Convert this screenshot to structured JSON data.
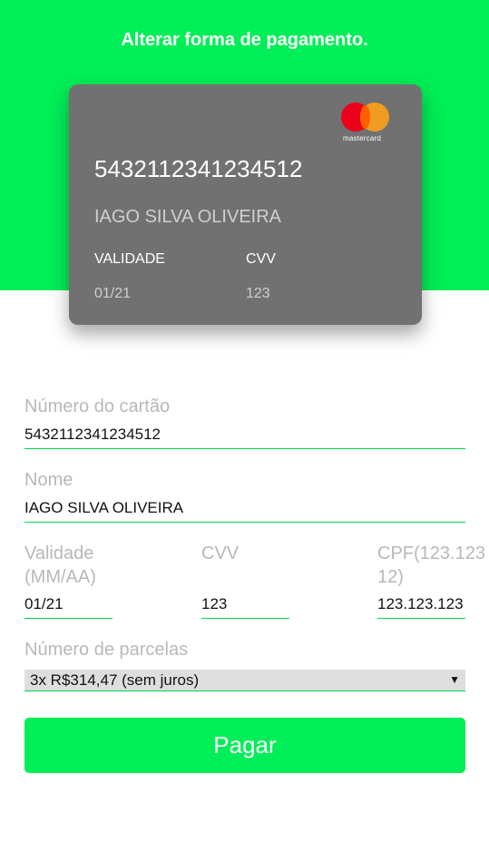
{
  "header": {
    "title": "Alterar forma de pagamento."
  },
  "card": {
    "brand_text": "mastercard",
    "number": "5432112341234512",
    "name": "IAGO SILVA OLIVEIRA",
    "validity_label": "VALIDADE",
    "validity_value": "01/21",
    "cvv_label": "CVV",
    "cvv_value": "123"
  },
  "form": {
    "number_label": "Número do cartão",
    "number_value": "5432112341234512",
    "name_label": "Nome",
    "name_value": "IAGO SILVA OLIVEIRA",
    "validity_label_line1": "Validade",
    "validity_label_line2": "(MM/AA)",
    "validity_value": "01/21",
    "cvv_label": "CVV",
    "cvv_value": "123",
    "cpf_label_line1": "CPF(123.123",
    "cpf_label_line2": "12)",
    "cpf_value": "123.123.123",
    "installments_label": "Número de parcelas",
    "installments_selected": "3x R$314,47 (sem juros)"
  },
  "actions": {
    "pay_label": "Pagar"
  },
  "colors": {
    "accent": "#00ee57",
    "card": "#717171"
  }
}
